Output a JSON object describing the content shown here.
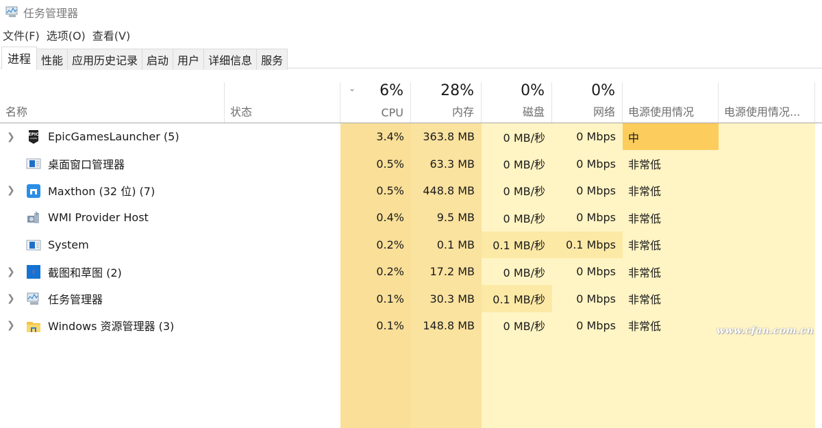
{
  "window": {
    "title": "任务管理器",
    "icon": "task-manager-icon"
  },
  "menu": [
    {
      "label": "文件(F)"
    },
    {
      "label": "选项(O)"
    },
    {
      "label": "查看(V)"
    }
  ],
  "tabs": [
    {
      "label": "进程",
      "active": true
    },
    {
      "label": "性能"
    },
    {
      "label": "应用历史记录"
    },
    {
      "label": "启动"
    },
    {
      "label": "用户"
    },
    {
      "label": "详细信息"
    },
    {
      "label": "服务"
    }
  ],
  "columns": {
    "name": {
      "label": "名称"
    },
    "status": {
      "label": "状态"
    },
    "cpu": {
      "label": "CPU",
      "total": "6%"
    },
    "memory": {
      "label": "内存",
      "total": "28%"
    },
    "disk": {
      "label": "磁盘",
      "total": "0%"
    },
    "network": {
      "label": "网络",
      "total": "0%"
    },
    "power": {
      "label": "电源使用情况"
    },
    "power_trend": {
      "label": "电源使用情况..."
    },
    "sort_indicator": "chevron-down"
  },
  "colors": {
    "heat_light": "#fff4c4",
    "heat_medium": "#fce9a5",
    "heat_strong": "#f9df98",
    "power_medium": "#fccc5c"
  },
  "processes": [
    {
      "name": "EpicGamesLauncher (5)",
      "icon": "epic-games-icon",
      "expandable": true,
      "cpu": "3.4%",
      "memory": "363.8 MB",
      "disk": "0 MB/秒",
      "network": "0 Mbps",
      "power": "中",
      "power_highlight": true
    },
    {
      "name": "桌面窗口管理器",
      "icon": "window-manager-icon",
      "expandable": false,
      "cpu": "0.5%",
      "memory": "63.3 MB",
      "disk": "0 MB/秒",
      "network": "0 Mbps",
      "power": "非常低"
    },
    {
      "name": "Maxthon (32 位) (7)",
      "icon": "maxthon-icon",
      "expandable": true,
      "cpu": "0.5%",
      "memory": "448.8 MB",
      "disk": "0 MB/秒",
      "network": "0 Mbps",
      "power": "非常低"
    },
    {
      "name": "WMI Provider Host",
      "icon": "wmi-host-icon",
      "expandable": false,
      "cpu": "0.4%",
      "memory": "9.5 MB",
      "disk": "0 MB/秒",
      "network": "0 Mbps",
      "power": "非常低"
    },
    {
      "name": "System",
      "icon": "system-icon",
      "expandable": false,
      "cpu": "0.2%",
      "memory": "0.1 MB",
      "disk": "0.1 MB/秒",
      "network": "0.1 Mbps",
      "power": "非常低",
      "disk_highlight": true,
      "network_highlight": true
    },
    {
      "name": "截图和草图 (2)",
      "icon": "snip-sketch-icon",
      "expandable": true,
      "cpu": "0.2%",
      "memory": "17.2 MB",
      "disk": "0 MB/秒",
      "network": "0 Mbps",
      "power": "非常低"
    },
    {
      "name": "任务管理器",
      "icon": "task-manager-icon",
      "expandable": true,
      "cpu": "0.1%",
      "memory": "30.3 MB",
      "disk": "0.1 MB/秒",
      "network": "0 Mbps",
      "power": "非常低",
      "disk_highlight": true
    },
    {
      "name": "Windows 资源管理器 (3)",
      "icon": "file-explorer-icon",
      "expandable": true,
      "cpu": "0.1%",
      "memory": "148.8 MB",
      "disk": "0 MB/秒",
      "network": "0 Mbps",
      "power": "非常低"
    }
  ],
  "watermark": "www.cfan.com.cn"
}
